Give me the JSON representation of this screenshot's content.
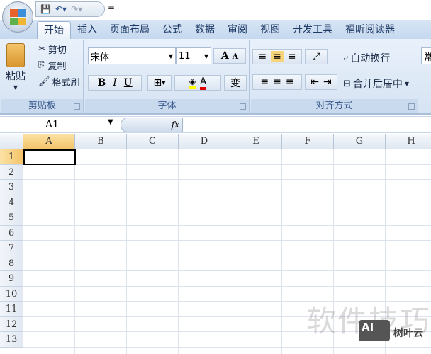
{
  "quick_access": {
    "save": "save-icon",
    "undo": "undo-icon",
    "redo": "redo-icon",
    "customize": "="
  },
  "tabs": [
    "开始",
    "插入",
    "页面布局",
    "公式",
    "数据",
    "审阅",
    "视图",
    "开发工具",
    "福昕阅读器"
  ],
  "active_tab": "开始",
  "clipboard": {
    "paste": "粘贴",
    "cut": "剪切",
    "copy": "复制",
    "format_painter": "格式刷",
    "label": "剪贴板"
  },
  "font": {
    "name": "宋体",
    "size": "11",
    "bold": "B",
    "italic": "I",
    "underline": "U",
    "grow": "A",
    "shrink": "A",
    "font_color": "A",
    "phonetic": "变",
    "label": "字体",
    "fill_color": "#ffff00",
    "text_color": "#e00000"
  },
  "alignment": {
    "wrap_text": "自动换行",
    "merge_center": "合并后居中",
    "label": "对齐方式"
  },
  "number": {
    "format_partial": "常"
  },
  "formula_bar": {
    "name_box": "A1",
    "fx": "fx",
    "value": ""
  },
  "columns": [
    "A",
    "B",
    "C",
    "D",
    "E",
    "F",
    "G",
    "H"
  ],
  "rows": [
    "1",
    "2",
    "3",
    "4",
    "5",
    "6",
    "7",
    "8",
    "9",
    "10",
    "11",
    "12",
    "13"
  ],
  "selected_cell": "A1",
  "watermark": {
    "text": "软件技巧",
    "logo": "AI",
    "brand": "树叶云"
  }
}
